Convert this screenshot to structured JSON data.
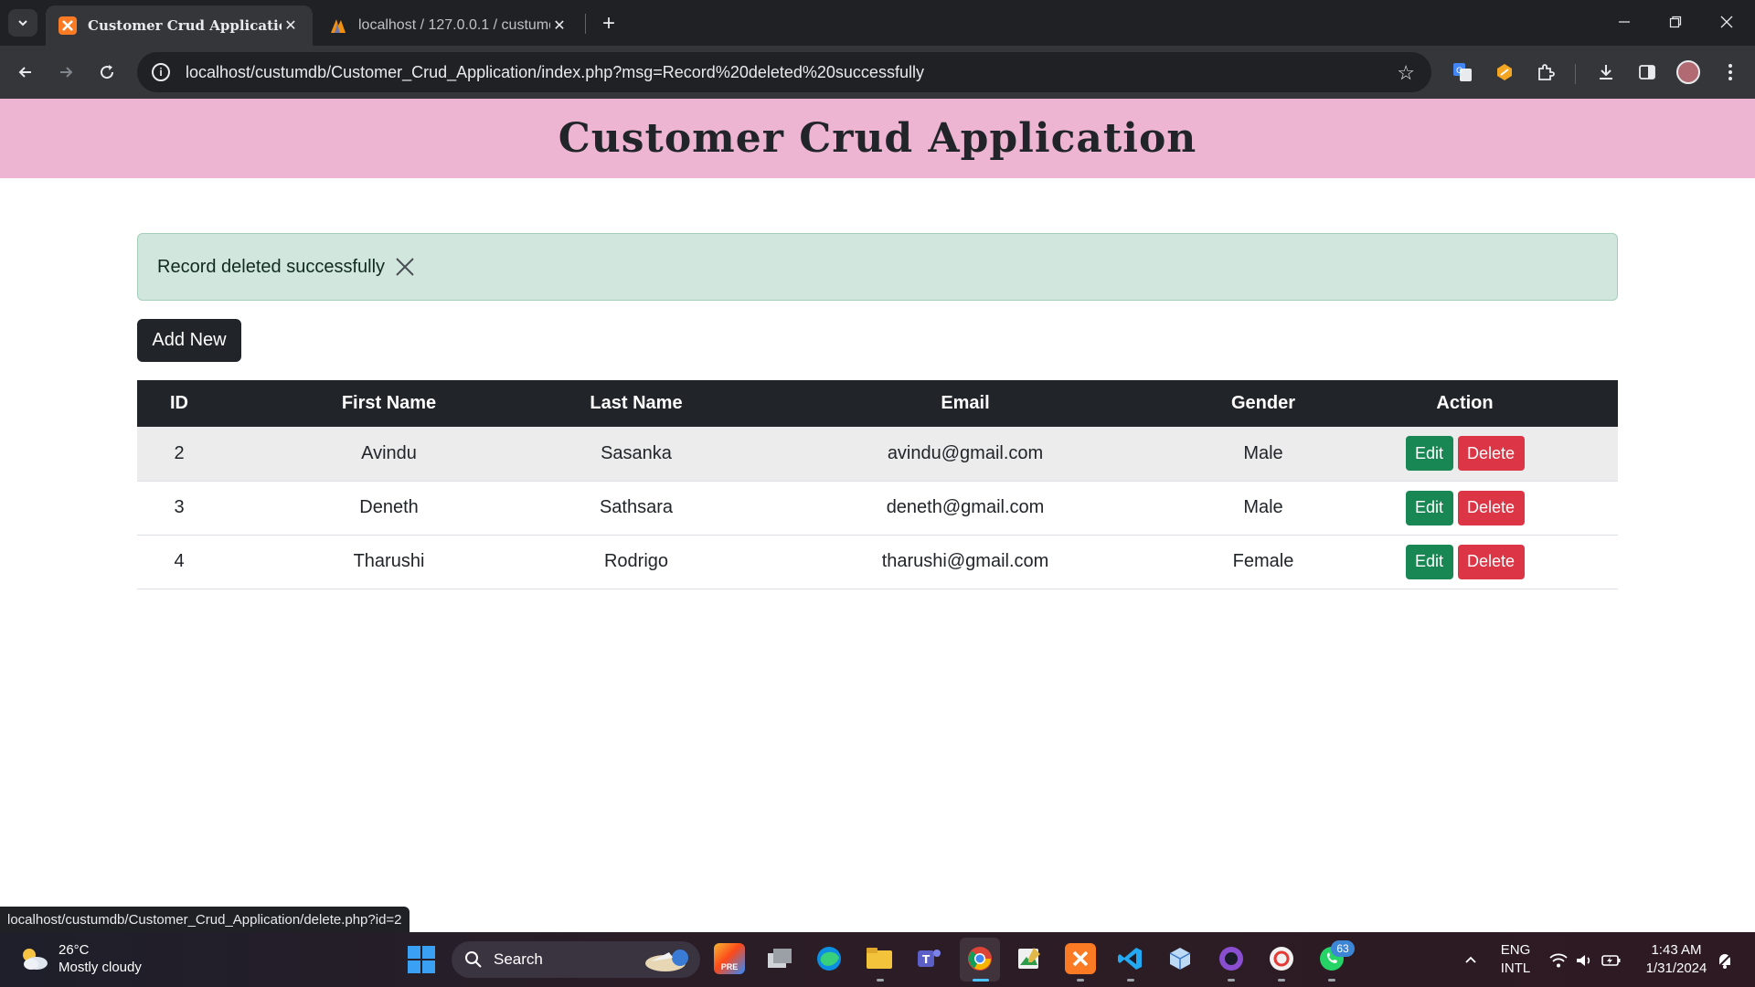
{
  "browser": {
    "tabs": [
      {
        "title": "Customer Crud Application",
        "active": true,
        "icon": "xampp-icon"
      },
      {
        "title": "localhost / 127.0.0.1 / custumdb",
        "active": false,
        "icon": "phpmyadmin-icon"
      }
    ],
    "address_url": "localhost/custumdb/Customer_Crud_Application/index.php?msg=Record%20deleted%20successfully",
    "status_url": "localhost/custumdb/Customer_Crud_Application/delete.php?id=2"
  },
  "page": {
    "title": "Customer Crud Application",
    "alert_message": "Record deleted successfully",
    "add_button_label": "Add New",
    "table": {
      "headers": [
        "ID",
        "First Name",
        "Last Name",
        "Email",
        "Gender",
        "Action"
      ],
      "rows": [
        {
          "id": "2",
          "first_name": "Avindu",
          "last_name": "Sasanka",
          "email": "avindu@gmail.com",
          "gender": "Male",
          "edit_label": "Edit",
          "delete_label": "Delete"
        },
        {
          "id": "3",
          "first_name": "Deneth",
          "last_name": "Sathsara",
          "email": "deneth@gmail.com",
          "gender": "Male",
          "edit_label": "Edit",
          "delete_label": "Delete"
        },
        {
          "id": "4",
          "first_name": "Tharushi",
          "last_name": "Rodrigo",
          "email": "tharushi@gmail.com",
          "gender": "Female",
          "edit_label": "Edit",
          "delete_label": "Delete"
        }
      ]
    }
  },
  "taskbar": {
    "weather": {
      "temp": "26°C",
      "condition": "Mostly cloudy"
    },
    "search_label": "Search",
    "whatsapp_badge": "63",
    "language": {
      "line1": "ENG",
      "line2": "INTL"
    },
    "clock": {
      "time": "1:43 AM",
      "date": "1/31/2024"
    }
  },
  "colors": {
    "header_bg": "#edb5d2",
    "alert_bg": "#d1e7dd",
    "table_header_bg": "#212529",
    "edit_button": "#198754",
    "delete_button": "#dc3545"
  }
}
